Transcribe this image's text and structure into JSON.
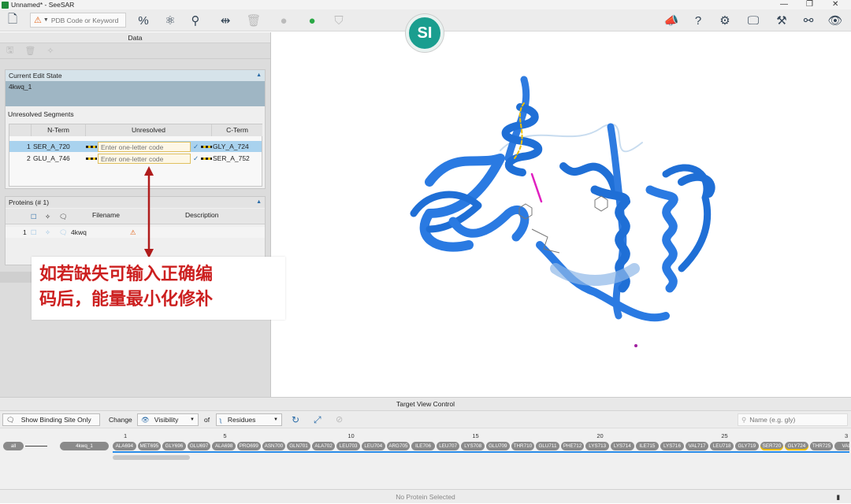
{
  "window": {
    "title": "Unnamed* - SeeSAR",
    "controls": [
      "—",
      "❐",
      "✕"
    ]
  },
  "toolbar": {
    "pdb_placeholder": "PDB Code or Keyword",
    "logo_text": "SI"
  },
  "data_panel": {
    "title": "Data",
    "edit_state": {
      "header": "Current Edit State",
      "value": "4kwq_1"
    },
    "segments": {
      "title": "Unresolved Segments",
      "columns": [
        "N-Term",
        "Unresolved",
        "C-Term"
      ],
      "rows": [
        {
          "index": "1",
          "nterm": "SER_A_720",
          "placeholder": "Enter one-letter code",
          "cterm": "GLY_A_724"
        },
        {
          "index": "2",
          "nterm": "GLU_A_746",
          "placeholder": "Enter one-letter code",
          "cterm": "SER_A_752"
        }
      ]
    },
    "proteins": {
      "header": "Proteins (# 1)",
      "columns": [
        "Filename",
        "Description"
      ],
      "rows": [
        {
          "index": "1",
          "filename": "4kwq"
        }
      ]
    }
  },
  "annotation": {
    "line1": "如若缺失可输入正确编",
    "line2": "码后，能量最小化修补",
    "color": "#cc1f1f"
  },
  "target_view": {
    "title": "Target View Control",
    "binding_site": "Show Binding Site Only",
    "change_label": "Change",
    "visibility": "Visibility",
    "of_label": "of",
    "residues": "Residues",
    "name_placeholder": "Name (e.g. gly)",
    "all_label": "all",
    "protein_label": "4kwq_1",
    "ticks": [
      "1",
      "5",
      "10",
      "15",
      "20",
      "25",
      "3"
    ],
    "residue_list": [
      "ALA694",
      "MET695",
      "GLY696",
      "GLU697",
      "ALA698",
      "PRO699",
      "ASN700",
      "GLN701",
      "ALA702",
      "LEU703",
      "LEU704",
      "ARG705",
      "ILE706",
      "LEU707",
      "LYS708",
      "GLU709",
      "THR710",
      "GLU711",
      "PHE712",
      "LYS713",
      "LYS714",
      "ILE715",
      "LYS716",
      "VAL717",
      "LEU718",
      "GLY719",
      "SER720",
      "GLY724",
      "THR725",
      "VAL"
    ]
  },
  "status": {
    "text": "No Protein Selected"
  },
  "colors": {
    "ribbon": "#1f6fd6",
    "accent": "#2a6ca8",
    "logo": "#1a9e8f"
  }
}
